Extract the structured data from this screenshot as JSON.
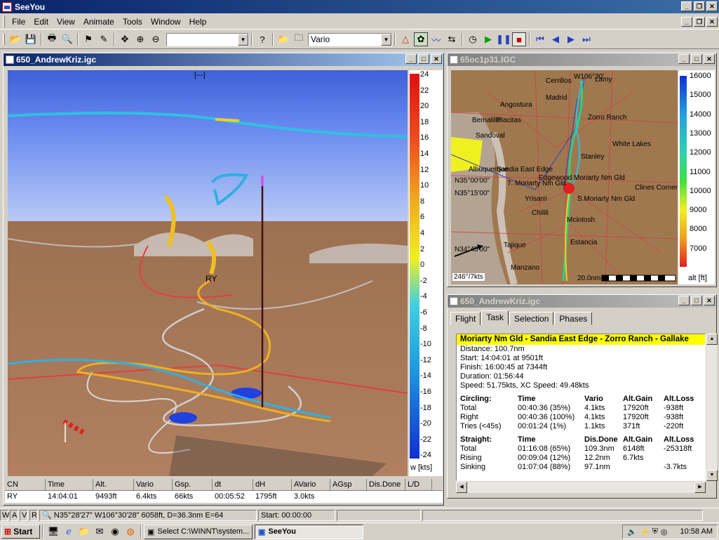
{
  "app": {
    "title": "SeeYou"
  },
  "menu": [
    "File",
    "Edit",
    "View",
    "Animate",
    "Tools",
    "Window",
    "Help"
  ],
  "toolbar": {
    "zoom_combo": "",
    "vario_combo": "Vario"
  },
  "win3d": {
    "title": "650_AndrewKriz.igc",
    "scale_labels": [
      "24",
      "22",
      "20",
      "18",
      "16",
      "14",
      "12",
      "10",
      "8",
      "6",
      "4",
      "2",
      "0",
      "-2",
      "-4",
      "-6",
      "-8",
      "-10",
      "-12",
      "-14",
      "-16",
      "-18",
      "-20",
      "-22",
      "-24"
    ],
    "scale_unit": "w [kts]",
    "top_marker": "[---]",
    "thermal_label": "RY",
    "table": {
      "headers": [
        "CN",
        "Time",
        "Alt.",
        "Vario",
        "Gsp.",
        "dt",
        "dH",
        "AVario",
        "AGsp",
        "Dis.Done",
        "L/D"
      ],
      "row": [
        "RY",
        "14:04:01",
        "9493ft",
        "6.4kts",
        "66kts",
        "00:05:52",
        "1795ft",
        "3.0kts",
        "",
        "",
        ""
      ]
    }
  },
  "winMap": {
    "title": "65oc1p31.IGC",
    "places": [
      "Cerrillos",
      "Lamy",
      "Madrid",
      "Angostura",
      "Bernalillo",
      "Placitas",
      "Zorro Ranch",
      "Sandoval",
      "White Lakes",
      "Stanley",
      "Albuquerque",
      "Sandia East Edge",
      "Edgewood",
      "Moriarty Nm Gld",
      "7. Moriarty Nm Gld",
      "Clines Corner",
      "S.Moriarty Nm Gld",
      "Yrisarri",
      "Chilili",
      "Mcintosh",
      "Tajique",
      "Estancia",
      "Manzano",
      "N35°15'00\"",
      "N35°00'00\"",
      "N34°45'00\"",
      "W106°30'"
    ],
    "wind": "246°/7kts",
    "scale_dist": "20.0nm",
    "alt_labels": [
      "16000",
      "15000",
      "14000",
      "13000",
      "12000",
      "11000",
      "10000",
      "9000",
      "8000",
      "7000"
    ],
    "alt_unit": "alt [ft]"
  },
  "winTask": {
    "title": "650_AndrewKriz.igc",
    "tabs": [
      "Flight",
      "Task",
      "Selection",
      "Phases"
    ],
    "task_name": "Moriarty Nm Gld - Sandia East Edge - Zorro Ranch - Gallake",
    "info": [
      "Distance: 100.7nm",
      "Start:  14:04:01 at 9501ft",
      "Finish:  16:00:45 at 7344ft",
      "Duration: 01:56:44",
      "Speed: 51.75kts,  XC Speed: 49.48kts"
    ],
    "circling": {
      "headers": [
        "Circling:",
        "Time",
        "Vario",
        "Alt.Gain",
        "Alt.Loss"
      ],
      "rows": [
        [
          "Total",
          "00:40:36 (35%)",
          "4.1kts",
          "17920ft",
          "-938ft"
        ],
        [
          "Right",
          "00:40:36 (100%)",
          "4.1kts",
          "17920ft",
          "-938ft"
        ],
        [
          "Tries (<45s)",
          "00:01:24 (1%)",
          "1.1kts",
          "371ft",
          "-220ft"
        ]
      ]
    },
    "straight": {
      "headers": [
        "Straight:",
        "Time",
        "Dis.Done",
        "Alt.Gain",
        "Alt.Loss"
      ],
      "rows": [
        [
          "Total",
          "01:16:08 (65%)",
          "109.3nm",
          "6148ft",
          "-25318ft"
        ],
        [
          "Rising",
          "00:09:04 (12%)",
          "12.2nm",
          "6.7kts",
          ""
        ],
        [
          "Sinking",
          "01:07:04 (88%)",
          "97.1nm",
          "",
          "-3.7kts"
        ]
      ]
    }
  },
  "statusbar": {
    "modes": [
      "W",
      "A",
      "V",
      "R"
    ],
    "coords": "N35°28'27\"  W106°30'28\" 6058ft, D=36.3nm E=64",
    "start": "Start: 00:00:00"
  },
  "taskbar": {
    "start": "Start",
    "items": [
      "Select C:\\WINNT\\system...",
      "SeeYou"
    ],
    "clock": "10:58 AM"
  }
}
